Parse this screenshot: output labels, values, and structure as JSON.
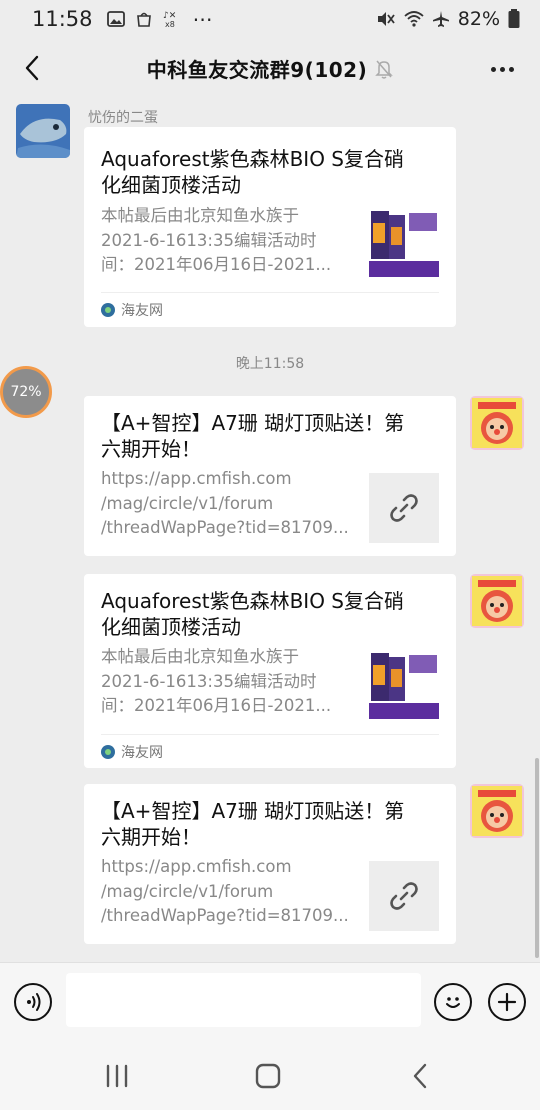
{
  "status_bar": {
    "time": "11:58",
    "battery": "82%",
    "left_icons": [
      "gallery-icon",
      "bag-icon",
      "call-status-icon"
    ],
    "more": "⋯"
  },
  "header": {
    "title": "中科鱼友交流群9(102)"
  },
  "messages": [
    {
      "sender": "忧伤的二蛋",
      "type": "article",
      "title_lines": [
        "Aquaforest紫色森林BIO S复合硝",
        "化细菌顶楼活动"
      ],
      "desc_lines": [
        "本帖最后由北京知鱼水族于",
        "2021-6-1613:35编辑活动时",
        "间：2021年06月16日-2021..."
      ],
      "source": "海友网"
    },
    {
      "type": "timestamp",
      "text": "晚上11:58"
    },
    {
      "type": "link",
      "title_lines": [
        "【A+智控】A7珊 瑚灯顶贴送！第",
        "六期开始！"
      ],
      "desc_lines": [
        "https://app.cmfish.com",
        "/mag/circle/v1/forum",
        "/threadWapPage?tid=81709..."
      ]
    },
    {
      "type": "article",
      "title_lines": [
        "Aquaforest紫色森林BIO S复合硝",
        "化细菌顶楼活动"
      ],
      "desc_lines": [
        "本帖最后由北京知鱼水族于",
        "2021-6-1613:35编辑活动时",
        "间：2021年06月16日-2021..."
      ],
      "source": "海友网"
    },
    {
      "type": "link",
      "title_lines": [
        "【A+智控】A7珊 瑚灯顶贴送！第",
        "六期开始！"
      ],
      "desc_lines": [
        "https://app.cmfish.com",
        "/mag/circle/v1/forum",
        "/threadWapPage?tid=81709..."
      ]
    }
  ],
  "badge": {
    "text": "72%",
    "progress": 0.72
  },
  "input": {
    "value": ""
  },
  "colors": {
    "background": "#ededed",
    "card": "#ffffff",
    "muted_text": "#888888",
    "badge_ring": "#f29a4a"
  }
}
